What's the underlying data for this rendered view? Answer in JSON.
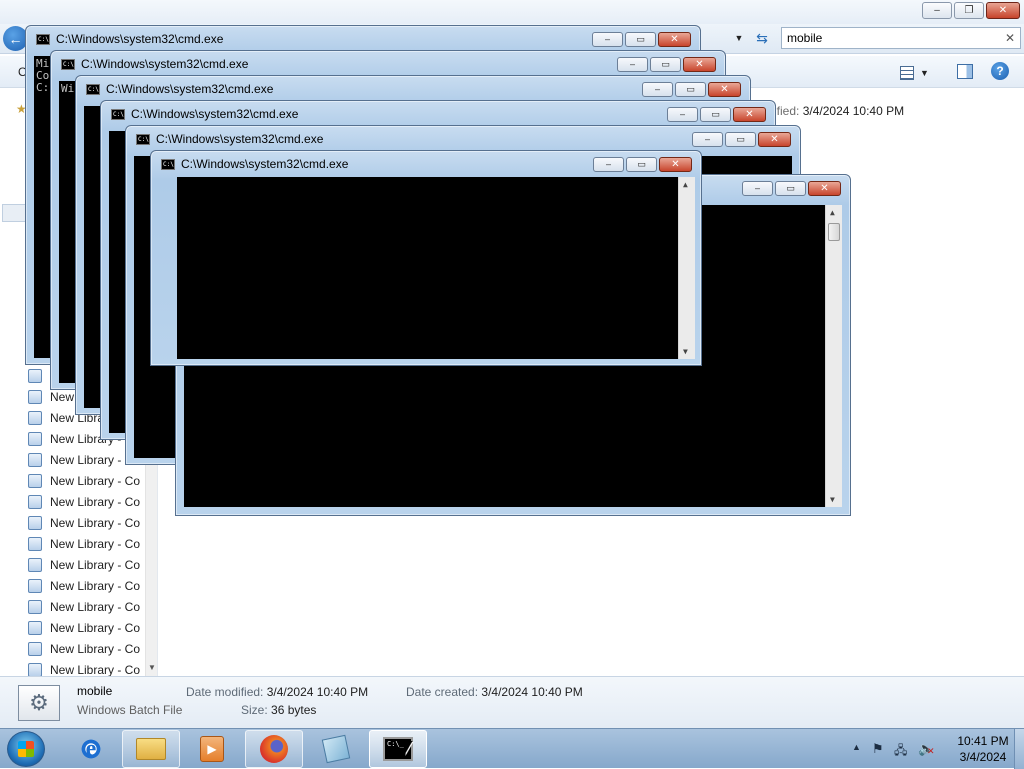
{
  "explorer": {
    "search_value": "mobile",
    "view_icon": "views-grid-icon",
    "help_icon": "help-icon",
    "header_date_label": "ified:",
    "header_date_value": "3/4/2024 10:40 PM",
    "nav_items": [
      "New Library - Co",
      "New Library - Co",
      "New Library - Co",
      "New Library - Co",
      "New Library - Co",
      "New Library - Co",
      "New Library - Co",
      "New Library - Co",
      "New Library - Co",
      "New Library - Co",
      "New Library - Co",
      "New Library - Co",
      "New Library - Co",
      "New Library - Co",
      "New Library - Co",
      "New Library - Co",
      "New Library - Co",
      "New Library - Co",
      "New Library - Co"
    ]
  },
  "details": {
    "name": "mobile",
    "type": "Windows Batch File",
    "date_modified_label": "Date modified:",
    "date_modified": "3/4/2024 10:40 PM",
    "date_created_label": "Date created:",
    "date_created": "3/4/2024 10:40 PM",
    "size_label": "Size:",
    "size": "36 bytes"
  },
  "cmd_windows": [
    {
      "title": "C:\\Windows\\system32\\cmd.exe",
      "lines": [
        "Mi",
        "Co",
        "",
        "C:"
      ]
    },
    {
      "title": "C:\\Windows\\system32\\cmd.exe",
      "lines": [
        "",
        "",
        "",
        "Wi"
      ]
    },
    {
      "title": "C:\\Windows\\system32\\cmd.exe",
      "lines": []
    },
    {
      "title": "C:\\Windows\\system32\\cmd.exe",
      "lines": []
    },
    {
      "title": "C:\\Windows\\system32\\cmd.exe",
      "lines": []
    },
    {
      "title": "C:\\Windows\\system32\\cmd.exe",
      "lines": []
    },
    {
      "title": "",
      "lines": []
    }
  ],
  "cmd_caption": {
    "minimize": "–",
    "maximize": "▭",
    "close": "✕"
  },
  "taskbar": {
    "icons": [
      "internet-explorer-icon",
      "windows-explorer-icon",
      "media-player-icon",
      "firefox-icon",
      "notepad-icon",
      "command-prompt-icon"
    ],
    "clock_time": "10:41 PM",
    "clock_date": "3/4/2024"
  }
}
